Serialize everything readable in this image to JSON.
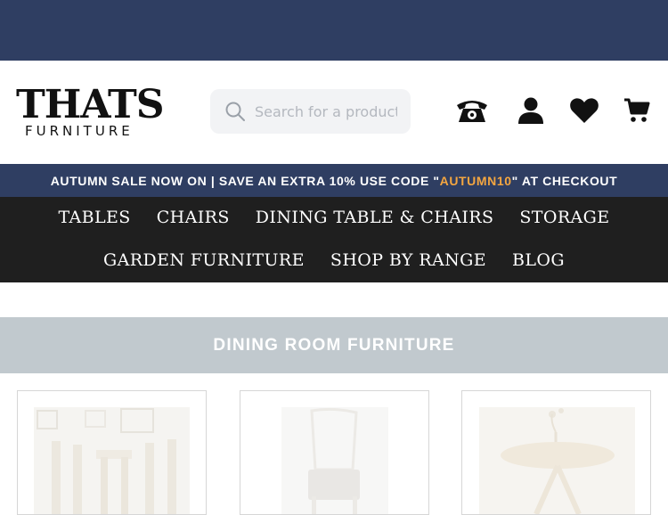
{
  "brand": {
    "logo_main": "THATS",
    "logo_sub": "FURNITURE"
  },
  "search": {
    "placeholder": "Search for a product"
  },
  "header_icons": [
    "phone-icon",
    "account-icon",
    "wishlist-heart-icon",
    "cart-icon"
  ],
  "promo": {
    "prefix": "AUTUMN SALE NOW ON | SAVE AN EXTRA 10% USE CODE \"",
    "code": "AUTUMN10",
    "suffix": "\" AT CHECKOUT"
  },
  "nav": {
    "row1": [
      "TABLES",
      "CHAIRS",
      "DINING TABLE & CHAIRS",
      "STORAGE"
    ],
    "row2": [
      "GARDEN FURNITURE",
      "SHOP BY RANGE",
      "BLOG"
    ]
  },
  "section": {
    "title": "DINING ROOM FURNITURE"
  },
  "colors": {
    "topbar": "#2f3e62",
    "promo_code": "#f4a640",
    "nav_bg": "#1f1f1f",
    "section_bar": "#c1c9ce"
  }
}
